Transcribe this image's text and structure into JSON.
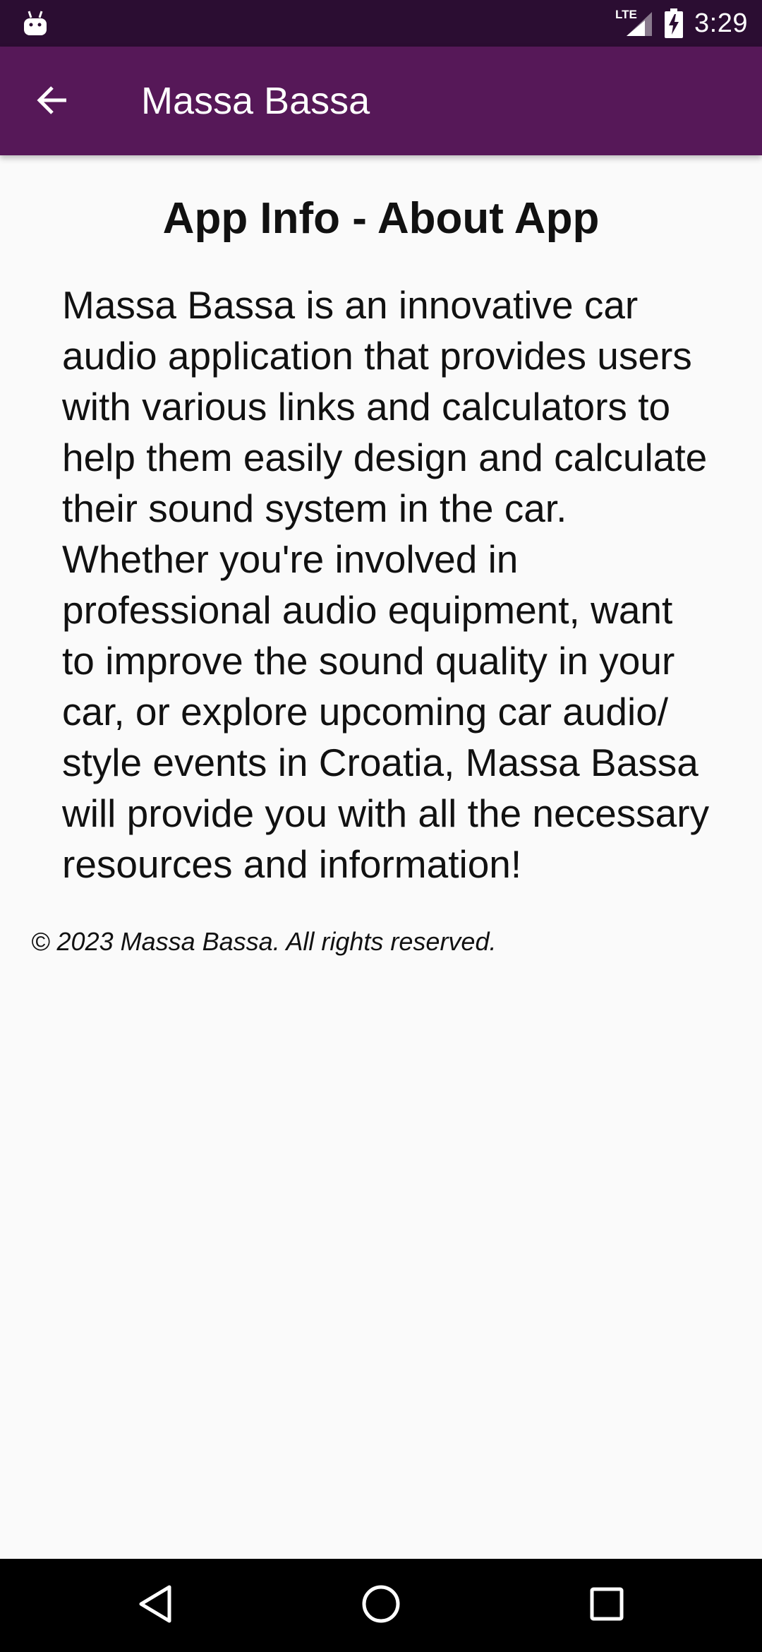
{
  "status_bar": {
    "time": "3:29",
    "network_label": "LTE",
    "icons": [
      "android-debug-icon",
      "signal-icon",
      "battery-charging-icon"
    ]
  },
  "app_bar": {
    "title": "Massa Bassa",
    "back_icon": "arrow-left-icon",
    "background_color": "#561858"
  },
  "content": {
    "heading": "App Info - About App",
    "description": "Massa Bassa is an innovative car audio application that provides users with various links and calculators to help them easily design and calculate their sound system in the car. Whether you're involved in professional audio equipment, want to improve the sound quality in your car, or explore upcoming car audio/ style events in Croatia, Massa Bassa will provide you with all the necessary resources and information!",
    "copyright": "© 2023 Massa Bassa. All rights reserved."
  },
  "nav_bar": {
    "buttons": [
      "back-triangle-icon",
      "home-circle-icon",
      "recents-square-icon"
    ]
  }
}
